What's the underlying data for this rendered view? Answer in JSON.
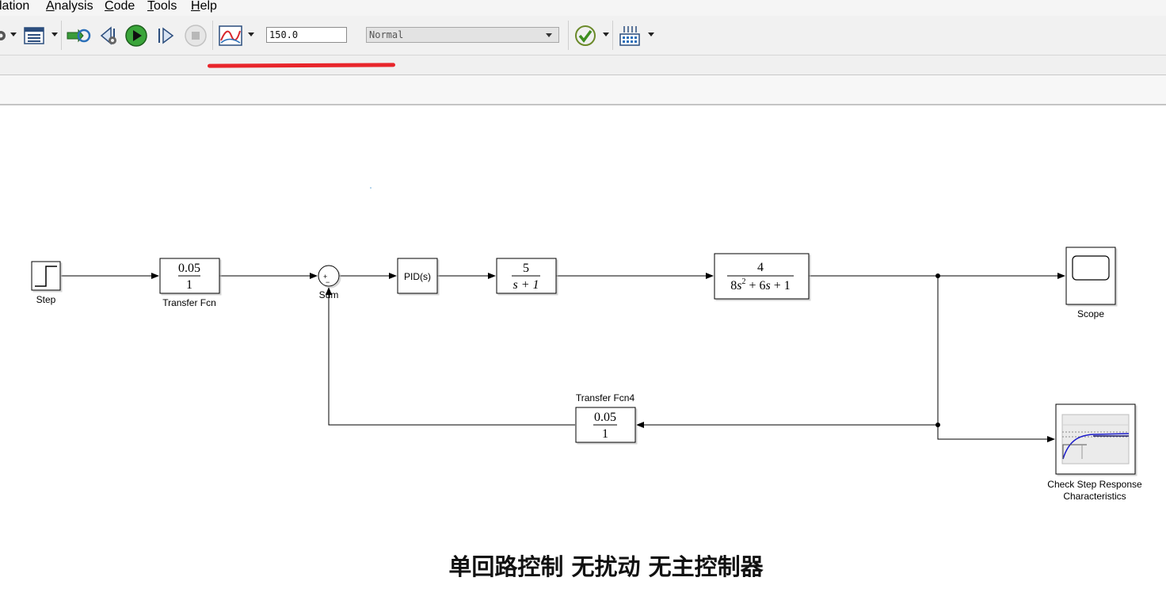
{
  "menubar": {
    "items": [
      {
        "prefix": "",
        "underline": "",
        "rest": "lation"
      },
      {
        "prefix": "",
        "underline": "A",
        "rest": "nalysis"
      },
      {
        "prefix": "",
        "underline": "C",
        "rest": "ode"
      },
      {
        "prefix": "",
        "underline": "T",
        "rest": "ools"
      },
      {
        "prefix": "",
        "underline": "H",
        "rest": "elp"
      }
    ]
  },
  "toolbar": {
    "stop_time": "150.0",
    "sim_mode": "Normal",
    "icons": [
      "settings-icon",
      "library-browser-icon",
      "update-diagram-icon",
      "step-back-icon",
      "run-icon",
      "step-forward-icon",
      "stop-icon",
      "data-inspector-icon",
      "model-advisor-icon",
      "build-icon"
    ]
  },
  "diagram": {
    "blocks": {
      "step": {
        "label": "Step"
      },
      "transfer_fcn": {
        "label": "Transfer Fcn",
        "num": "0.05",
        "den": "1"
      },
      "sum": {
        "label": "Sum",
        "sign_top": "+",
        "sign_bottom": "−"
      },
      "pid": {
        "label": "PID(s)"
      },
      "plant1": {
        "num": "5",
        "den": "s + 1"
      },
      "plant2": {
        "num": "4",
        "den_a": "8",
        "den_b": "s",
        "den_exp": "2",
        "den_c": " + 6",
        "den_d": "s",
        "den_e": " + 1"
      },
      "scope": {
        "label": "Scope"
      },
      "transfer_fcn4": {
        "label": "Transfer Fcn4",
        "num": "0.05",
        "den": "1"
      },
      "check_step": {
        "label_line1": "Check Step Response",
        "label_line2": "Characteristics"
      }
    }
  },
  "footer": {
    "title": "单回路控制 无扰动 无主控制器"
  },
  "colors": {
    "annotation_underline": "#e8252b",
    "run_green": "#3aa53a"
  }
}
